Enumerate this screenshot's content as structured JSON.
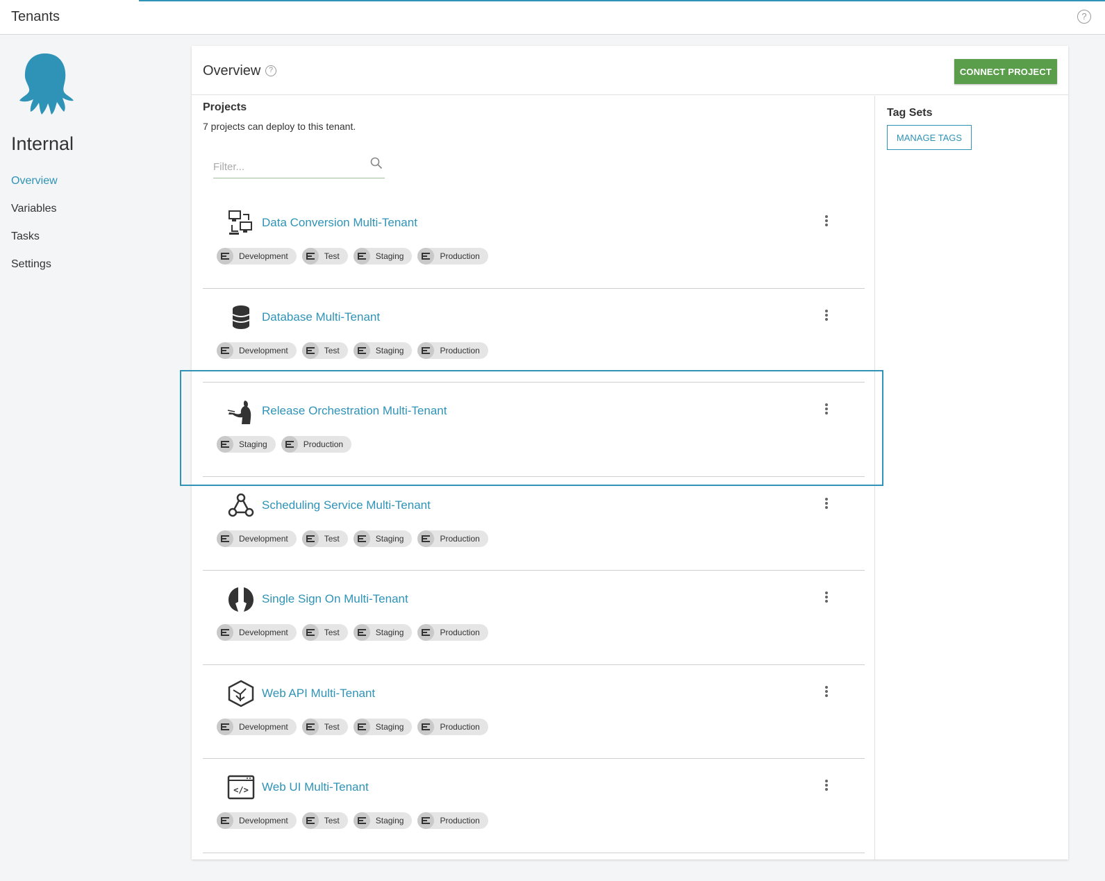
{
  "header": {
    "title": "Tenants"
  },
  "sidebar": {
    "tenant_name": "Internal",
    "nav": [
      {
        "label": "Overview",
        "active": true
      },
      {
        "label": "Variables",
        "active": false
      },
      {
        "label": "Tasks",
        "active": false
      },
      {
        "label": "Settings",
        "active": false
      }
    ]
  },
  "overview": {
    "title": "Overview",
    "connect_label": "CONNECT PROJECT",
    "projects_heading": "Projects",
    "projects_subtitle": "7 projects can deploy to this tenant.",
    "filter_placeholder": "Filter...",
    "tag_sets_heading": "Tag Sets",
    "manage_tags_label": "MANAGE TAGS"
  },
  "projects": [
    {
      "name": "Data Conversion Multi-Tenant",
      "icon": "servers-icon",
      "environments": [
        "Development",
        "Test",
        "Staging",
        "Production"
      ]
    },
    {
      "name": "Database Multi-Tenant",
      "icon": "database-icon",
      "environments": [
        "Development",
        "Test",
        "Staging",
        "Production"
      ]
    },
    {
      "name": "Release Orchestration Multi-Tenant",
      "icon": "conductor-icon",
      "environments": [
        "Staging",
        "Production"
      ]
    },
    {
      "name": "Scheduling Service Multi-Tenant",
      "icon": "webhook-icon",
      "environments": [
        "Development",
        "Test",
        "Staging",
        "Production"
      ]
    },
    {
      "name": "Single Sign On Multi-Tenant",
      "icon": "sso-icon",
      "environments": [
        "Development",
        "Test",
        "Staging",
        "Production"
      ]
    },
    {
      "name": "Web API Multi-Tenant",
      "icon": "api-cube-icon",
      "environments": [
        "Development",
        "Test",
        "Staging",
        "Production"
      ]
    },
    {
      "name": "Web UI Multi-Tenant",
      "icon": "code-window-icon",
      "environments": [
        "Development",
        "Test",
        "Staging",
        "Production"
      ]
    }
  ],
  "highlighted_project": "Release Orchestration Multi-Tenant",
  "colors": {
    "accent": "#2f93b7",
    "connect_button": "#5a9e4c",
    "logo": "#2f93b7"
  }
}
